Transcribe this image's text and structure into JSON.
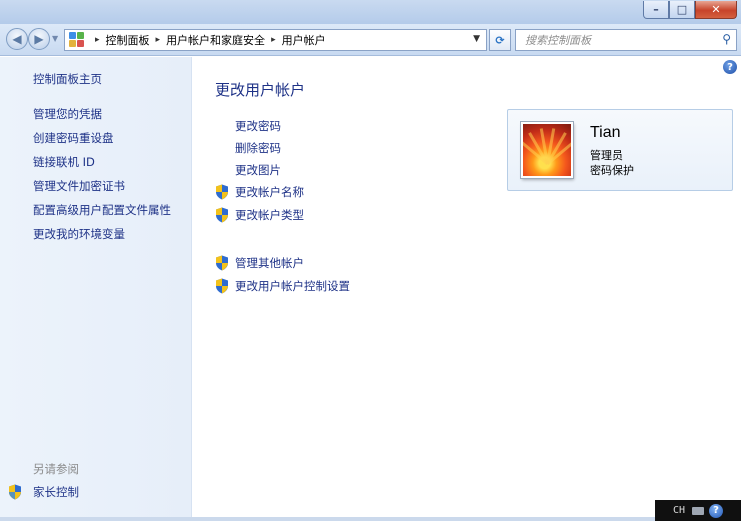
{
  "window": {
    "minimize_label": "–",
    "maximize_label": "□",
    "close_label": "✕"
  },
  "nav": {
    "back_label": "◀",
    "forward_label": "▶",
    "breadcrumb": [
      "控制面板",
      "用户帐户和家庭安全",
      "用户帐户"
    ],
    "breadcrumb_separator": "▸",
    "search_placeholder": "搜索控制面板"
  },
  "sidebar": {
    "home": "控制面板主页",
    "tasks": [
      "管理您的凭据",
      "创建密码重设盘",
      "链接联机 ID",
      "管理文件加密证书",
      "配置高级用户配置文件属性",
      "更改我的环境变量"
    ],
    "see_also_heading": "另请参阅",
    "see_also": [
      {
        "label": "家长控制",
        "icon": "uac-shield-icon"
      }
    ]
  },
  "main": {
    "title": "更改用户帐户",
    "tasks": [
      {
        "label": "更改密码",
        "shield": false
      },
      {
        "label": "删除密码",
        "shield": false
      },
      {
        "label": "更改图片",
        "shield": false
      },
      {
        "label": "更改帐户名称",
        "shield": true
      },
      {
        "label": "更改帐户类型",
        "shield": true
      }
    ],
    "other_tasks": [
      {
        "label": "管理其他帐户",
        "shield": true
      },
      {
        "label": "更改用户帐户控制设置",
        "shield": true
      }
    ]
  },
  "user": {
    "name": "Tian",
    "role": "管理员",
    "status": "密码保护"
  },
  "langbar": {
    "lang": "CH"
  },
  "colors": {
    "link": "#1e3287",
    "sidebar_bg": "#e6eef9",
    "titlebar_bg": "#b4cbea",
    "close_button": "#c7432a"
  }
}
